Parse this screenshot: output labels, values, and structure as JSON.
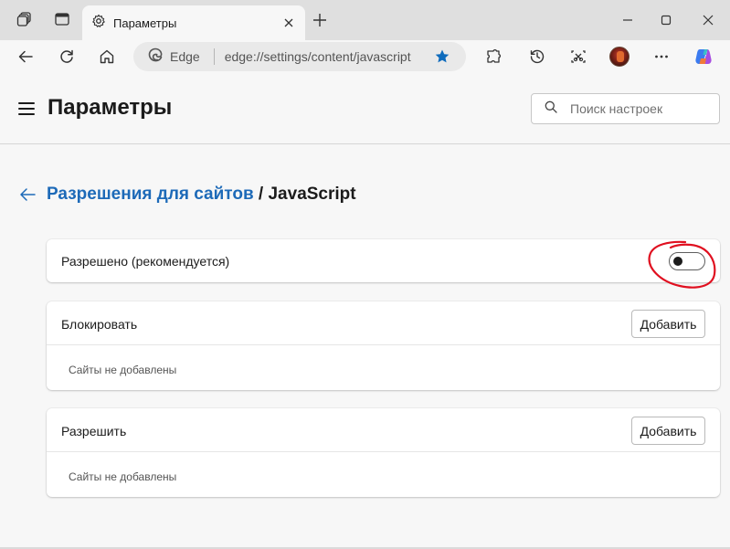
{
  "browser": {
    "tab": {
      "title": "Параметры"
    },
    "address": {
      "site_label": "Edge",
      "url": "edge://settings/content/javascript"
    }
  },
  "settings": {
    "title": "Параметры",
    "search": {
      "placeholder": "Поиск настроек"
    }
  },
  "breadcrumb": {
    "parent": "Разрешения для сайтов",
    "current": " / JavaScript"
  },
  "allowed": {
    "label": "Разрешено (рекомендуется)",
    "enabled": false
  },
  "block_section": {
    "title": "Блокировать",
    "add_label": "Добавить",
    "empty_text": "Сайты не добавлены"
  },
  "allow_section": {
    "title": "Разрешить",
    "add_label": "Добавить",
    "empty_text": "Сайты не добавлены"
  },
  "colors": {
    "accent": "#1d6ab8",
    "annotation": "#e01020",
    "favorite_star": "#0f6cbd"
  }
}
